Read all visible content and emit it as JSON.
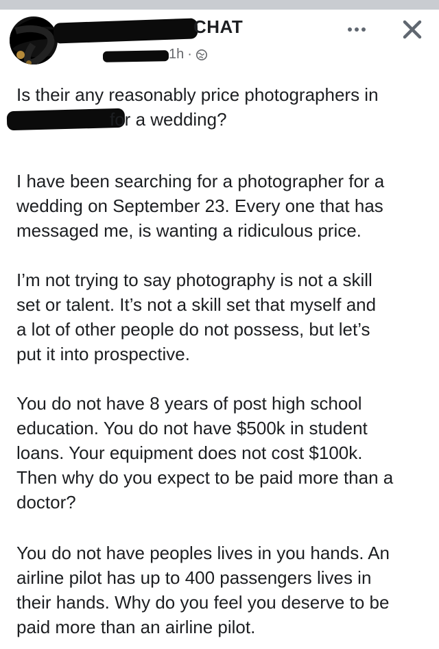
{
  "header": {
    "group_name_visible_tail": "CHAT",
    "timestamp": "1h",
    "separator": "·",
    "audience_icon": "globe-icon",
    "more_icon": "more-options-icon",
    "close_icon": "close-icon"
  },
  "post": {
    "title_line1": "Is their any reasonably price photographers in",
    "title_line2_tail": "for a wedding?",
    "paragraphs": [
      "I have been searching for a photographer for a\nwedding on September 23. Every one that has\nmessaged me, is wanting a ridiculous price.",
      "I’m not trying to say photography is not a skill\nset or talent. It’s not a skill set that myself and\na lot of other people do not possess, but let’s\nput it into prospective.",
      "You do not have 8 years of post high school\neducation. You do not have $500k in student\nloans. Your equipment does not cost $100k.\nThen why do you expect to be paid more than a\ndoctor?",
      "You do not have peoples lives in you hands. An\nairline pilot has up to 400 passengers lives in\ntheir hands. Why do you feel you deserve to be\npaid more than an airline pilot."
    ]
  },
  "colors": {
    "text": "#1c1e21",
    "meta": "#65676b",
    "redaction": "#0b0b0b",
    "top_bar": "#c9ccd1"
  }
}
